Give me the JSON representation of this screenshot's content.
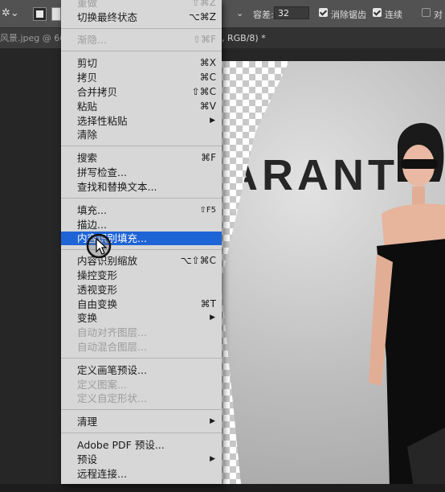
{
  "options_bar": {
    "tool_icon": "magic-wand-icon",
    "tolerance_label": "容差:",
    "tolerance_value": "32",
    "anti_alias_label": "消除锯齿",
    "contiguous_label": "连续",
    "sample_all_label": "对"
  },
  "tabs": {
    "doc1": "风景.jpeg @ 66",
    "doc2_partial": "0, RGB/8) *"
  },
  "canvas": {
    "wall_text": "ARANT"
  },
  "menu": {
    "items": [
      {
        "label": "重做",
        "shortcut": "⇧⌘Z",
        "disabled": true
      },
      {
        "label": "切换最终状态",
        "shortcut": "⌥⌘Z"
      },
      {
        "label": "渐隐...",
        "shortcut": "⇧⌘F",
        "disabled": true
      },
      {
        "label": "剪切",
        "shortcut": "⌘X"
      },
      {
        "label": "拷贝",
        "shortcut": "⌘C"
      },
      {
        "label": "合并拷贝",
        "shortcut": "⇧⌘C"
      },
      {
        "label": "粘贴",
        "shortcut": "⌘V"
      },
      {
        "label": "选择性粘贴",
        "submenu": true
      },
      {
        "label": "清除"
      },
      {
        "label": "搜索",
        "shortcut": "⌘F"
      },
      {
        "label": "拼写检查..."
      },
      {
        "label": "查找和替换文本..."
      },
      {
        "label": "填充...",
        "shortcut": "⇧F5"
      },
      {
        "label": "描边..."
      },
      {
        "label": "内容识别填充...",
        "highlighted": true
      },
      {
        "label": "内容识别缩放",
        "shortcut": "⌥⇧⌘C"
      },
      {
        "label": "操控变形"
      },
      {
        "label": "透视变形"
      },
      {
        "label": "自由变换",
        "shortcut": "⌘T"
      },
      {
        "label": "变换",
        "submenu": true
      },
      {
        "label": "自动对齐图层...",
        "disabled": true
      },
      {
        "label": "自动混合图层...",
        "disabled": true
      },
      {
        "label": "定义画笔预设..."
      },
      {
        "label": "定义图案...",
        "disabled": true
      },
      {
        "label": "定义自定形状...",
        "disabled": true
      },
      {
        "label": "清理",
        "submenu": true
      },
      {
        "label": "Adobe PDF 预设..."
      },
      {
        "label": "预设",
        "submenu": true
      },
      {
        "label": "远程连接..."
      }
    ]
  }
}
